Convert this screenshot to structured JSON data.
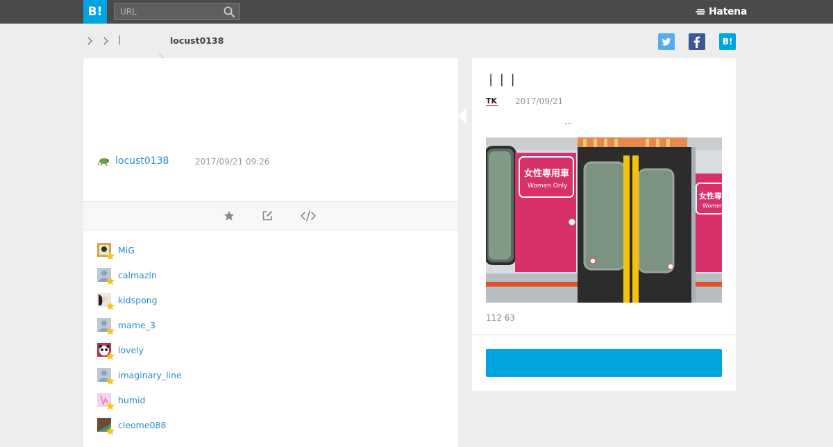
{
  "header": {
    "logo_text": "B!",
    "search_placeholder": "URL",
    "brand": "Hatena"
  },
  "breadcrumb": {
    "separator": "|",
    "user": "locust0138"
  },
  "share": {
    "hatena_label": "B!"
  },
  "comment": {
    "author": "locust0138",
    "timestamp": "2017/09/21 09:26"
  },
  "stars": [
    {
      "name": "MiG",
      "avatar_color": "#c8a95a"
    },
    {
      "name": "calmazin",
      "avatar_color": "#9fb3c6"
    },
    {
      "name": "kidspong",
      "avatar_color": "#e8d9cf"
    },
    {
      "name": "mame_3",
      "avatar_color": "#9fb3c6"
    },
    {
      "name": "lovely",
      "avatar_color": "#b23a58"
    },
    {
      "name": "imaginary_line",
      "avatar_color": "#9fb3c6"
    },
    {
      "name": "humid",
      "avatar_color": "#f1b8d8"
    },
    {
      "name": "cleome088",
      "avatar_color": "#6b4a3a"
    }
  ],
  "entry": {
    "title": "| | |",
    "site_logo": "TK",
    "date": "2017/09/21",
    "excerpt": "...",
    "counts": "112 63"
  },
  "image_signs": {
    "left_sign_jp": "女性専用車",
    "left_sign_en": "Women Only",
    "right_sign_jp": "女性専用",
    "right_sign_en": "Women"
  },
  "colors": {
    "accent": "#00a4de",
    "topbar": "#4a4a4a",
    "link": "#2a8ec8",
    "star": "#f5c518"
  }
}
